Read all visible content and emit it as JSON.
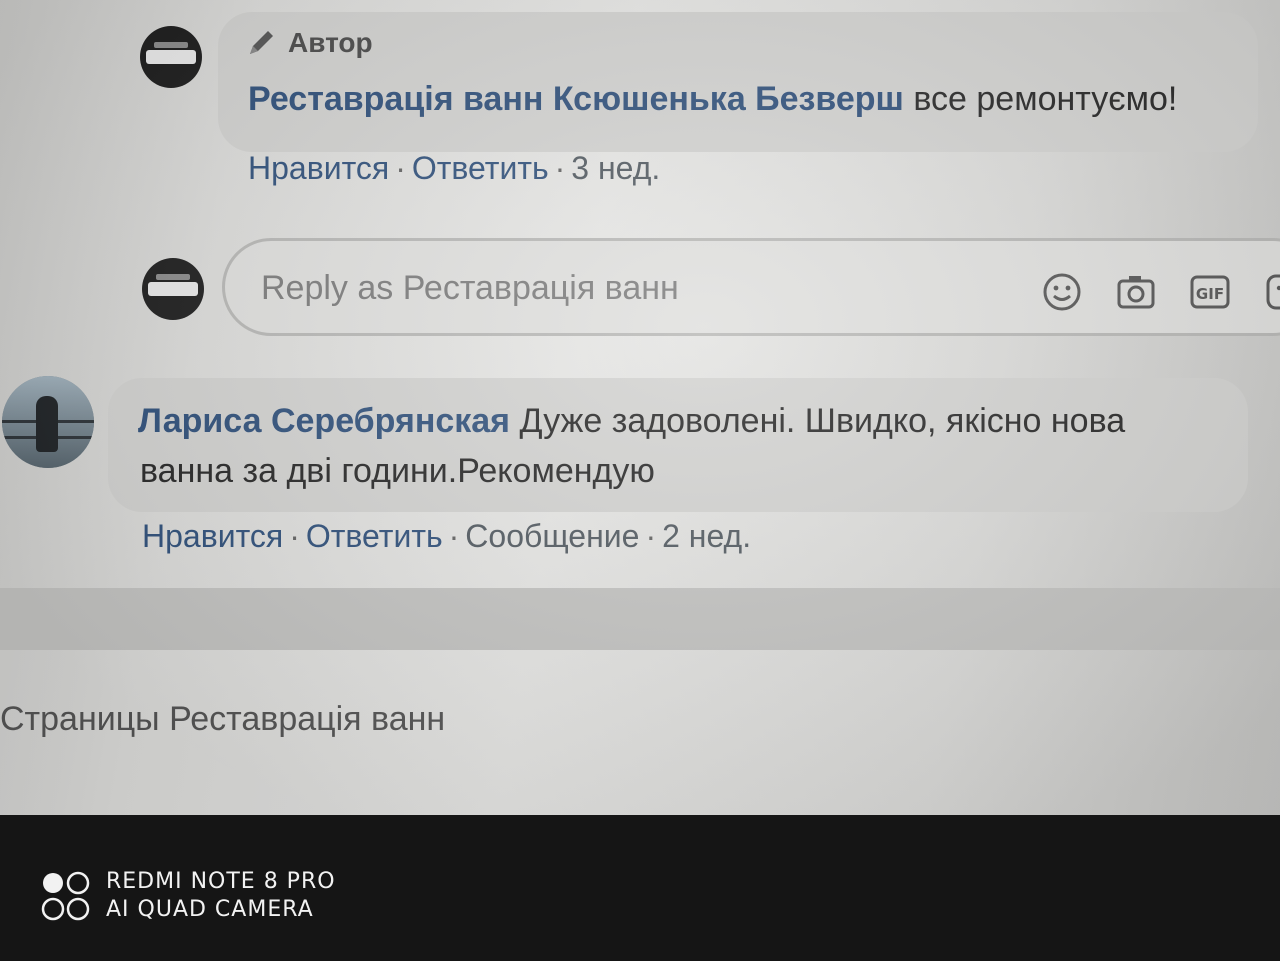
{
  "comments": [
    {
      "badge": "Автор",
      "author": "Реставрація ванн",
      "mention": "Ксюшенька Безверш",
      "text": "все ремонтуємо!",
      "actions": {
        "like": "Нравится",
        "reply": "Ответить",
        "time": "3 нед."
      }
    },
    {
      "author": "Лариса Серебрянская",
      "text_line1": "Дуже задоволені. Швидко, якісно нова",
      "text_line2": "ванна за дві години.Рекомендую",
      "actions": {
        "like": "Нравится",
        "reply": "Ответить",
        "message": "Сообщение",
        "time": "2 нед."
      }
    }
  ],
  "reply": {
    "placeholder": "Reply as Реставрація ванн",
    "icons": [
      "emoji-icon",
      "camera-icon",
      "gif-icon",
      "sticker-icon"
    ]
  },
  "footer": {
    "link": "Страницы Реставрація ванн"
  },
  "watermark": {
    "line1": "REDMI NOTE 8 PRO",
    "line2": "AI QUAD CAMERA"
  }
}
